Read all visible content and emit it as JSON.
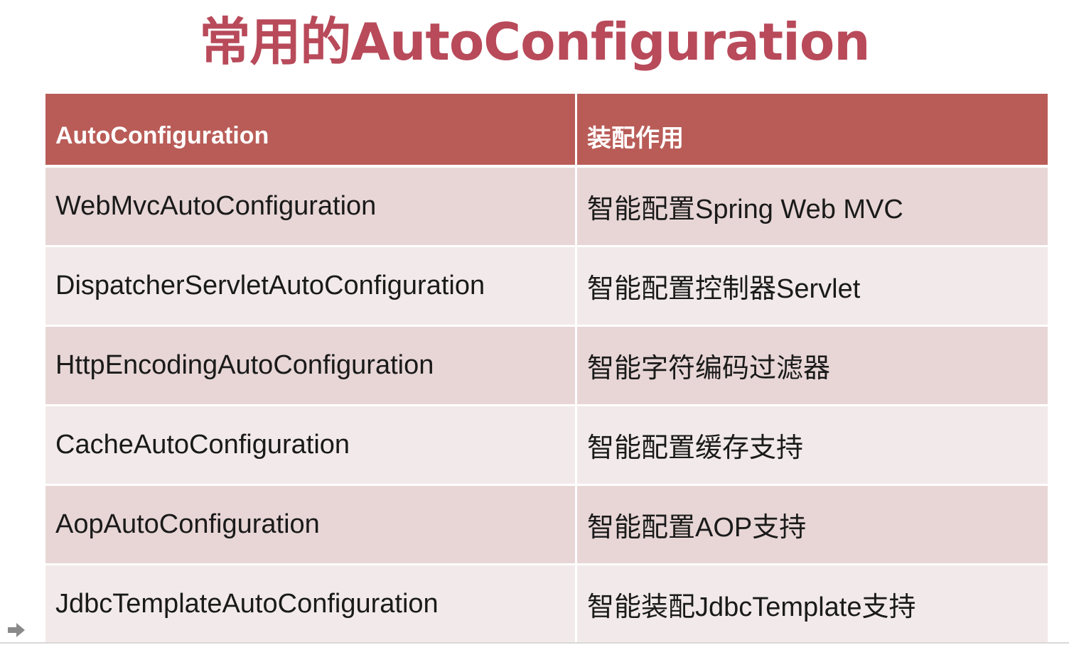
{
  "title": "常用的AutoConfiguration",
  "table": {
    "headers": [
      "AutoConfiguration",
      "装配作用"
    ],
    "rows": [
      [
        "WebMvcAutoConfiguration",
        "智能配置Spring Web MVC"
      ],
      [
        "DispatcherServletAutoConfiguration",
        "智能配置控制器Servlet"
      ],
      [
        "HttpEncodingAutoConfiguration",
        "智能字符编码过滤器"
      ],
      [
        "CacheAutoConfiguration",
        "智能配置缓存支持"
      ],
      [
        "AopAutoConfiguration",
        "智能配置AOP支持"
      ],
      [
        "JdbcTemplateAutoConfiguration",
        "智能装配JdbcTemplate支持"
      ]
    ]
  },
  "colors": {
    "title": "#b84a5a",
    "header_bg": "#b95c57",
    "row_odd_bg": "#e8d6d6",
    "row_even_bg": "#f2eaea"
  },
  "icons": {
    "pointer": "arrow-right-icon"
  }
}
